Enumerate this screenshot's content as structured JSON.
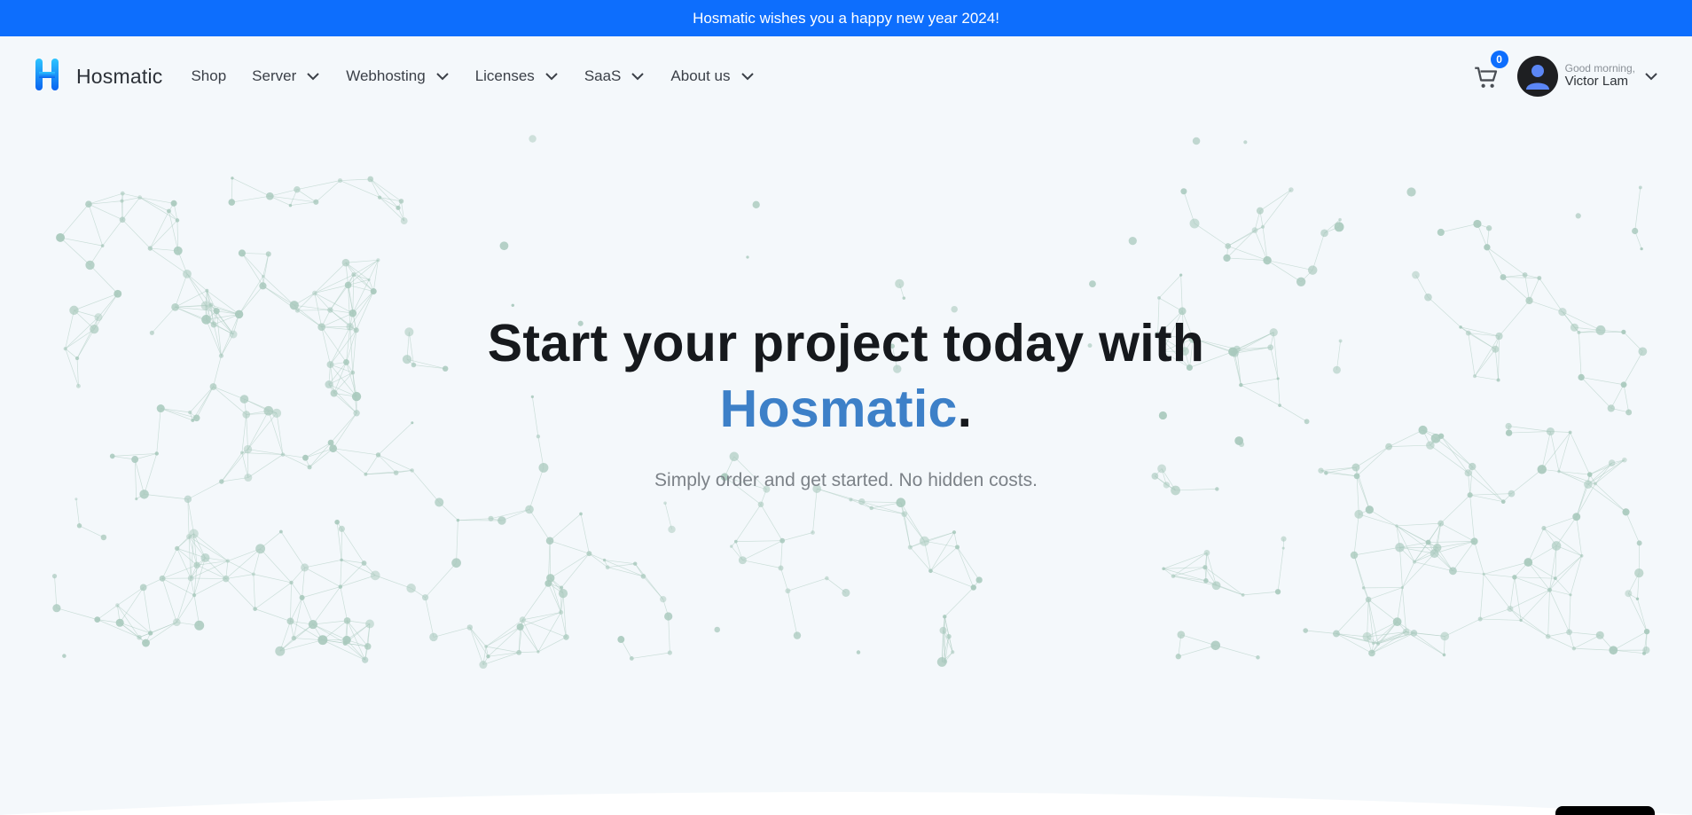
{
  "announcement": {
    "text": "Hosmatic wishes you a happy new year 2024!"
  },
  "header": {
    "logo_text": "Hosmatic",
    "nav": [
      {
        "label": "Shop",
        "has_dropdown": false
      },
      {
        "label": "Server",
        "has_dropdown": true
      },
      {
        "label": "Webhosting",
        "has_dropdown": true
      },
      {
        "label": "Licenses",
        "has_dropdown": true
      },
      {
        "label": "SaaS",
        "has_dropdown": true
      },
      {
        "label": "About us",
        "has_dropdown": true
      }
    ],
    "cart_count": "0",
    "user": {
      "greeting": "Good morning,",
      "name": "Victor Lam"
    }
  },
  "hero": {
    "title_line1": "Start your project today with",
    "title_brand": "Hosmatic",
    "title_period": ".",
    "subtitle": "Simply order and get started. No hidden costs."
  },
  "colors": {
    "announcement_bg": "#0d6efd",
    "brand_blue": "#3d80c8",
    "page_bg": "#f4f8fb",
    "particle": "#a9c9bd"
  },
  "icons": [
    "logo-h-icon",
    "chevron-down-icon",
    "cart-icon",
    "user-avatar-icon"
  ]
}
